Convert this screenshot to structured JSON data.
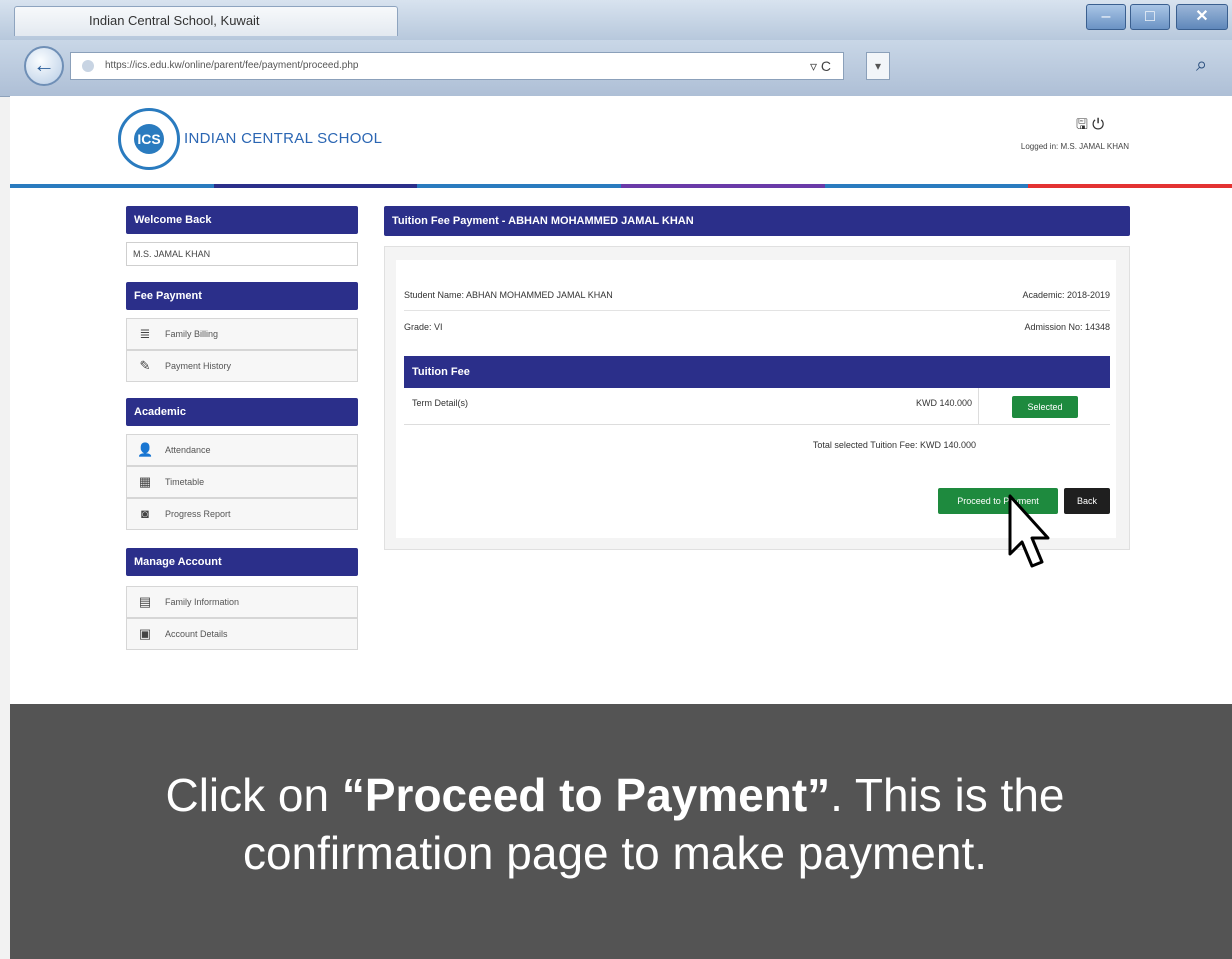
{
  "browser": {
    "tab_title": "Indian Central School, Kuwait",
    "address": "https://ics.edu.kw/online/parent/fee/payment/proceed.php",
    "refresh_glyph": "▿ C",
    "dropdown_glyph": "▾",
    "search_glyph": "⌕",
    "min_glyph": "–",
    "max_glyph": "□",
    "close_glyph": "✕",
    "back_glyph": "←"
  },
  "header": {
    "school_name": "INDIAN CENTRAL SCHOOL",
    "logo_glyph": "ICS",
    "icons": "🖫  ⏻",
    "logged_in": "Logged in: M.S. JAMAL KHAN"
  },
  "stripes": [
    "#2a7bbf",
    "#2b2f8a",
    "#2a7bbf",
    "#6a3aa8",
    "#2a7bbf",
    "#e33232"
  ],
  "sidebar": {
    "welcome_title": "Welcome Back",
    "user_name": "M.S. JAMAL KHAN",
    "sections": [
      {
        "title": "Fee Payment",
        "items": [
          {
            "label": "Family Billing",
            "icon": "≣"
          },
          {
            "label": "Payment History",
            "icon": "✎"
          }
        ]
      },
      {
        "title": "Academic",
        "items": [
          {
            "label": "Attendance",
            "icon": "👤"
          },
          {
            "label": "Timetable",
            "icon": "▦"
          },
          {
            "label": "Progress Report",
            "icon": "◙"
          }
        ]
      },
      {
        "title": "Manage Account",
        "items": [
          {
            "label": "Family Information",
            "icon": "▤"
          },
          {
            "label": "Account Details",
            "icon": "▣"
          }
        ]
      }
    ]
  },
  "main": {
    "title": "Tuition Fee Payment - ABHAN MOHAMMED JAMAL KHAN",
    "student_name": "Student Name: ABHAN MOHAMMED JAMAL KHAN",
    "academic_year": "Academic: 2018-2019",
    "grade": "Grade: VI",
    "admission_no": "Admission No: 14348",
    "fee_section": "Tuition Fee",
    "term_label": "Term Detail(s)",
    "term_amount": "KWD 140.000",
    "selected_label": "Selected",
    "total": "Total selected Tuition Fee: KWD 140.000",
    "proceed_label": "Proceed to Payment",
    "back_label": "Back"
  },
  "caption": {
    "before": "Click on ",
    "highlight": "“Proceed to Payment”",
    "after": ". This is the confirmation page to make payment."
  }
}
